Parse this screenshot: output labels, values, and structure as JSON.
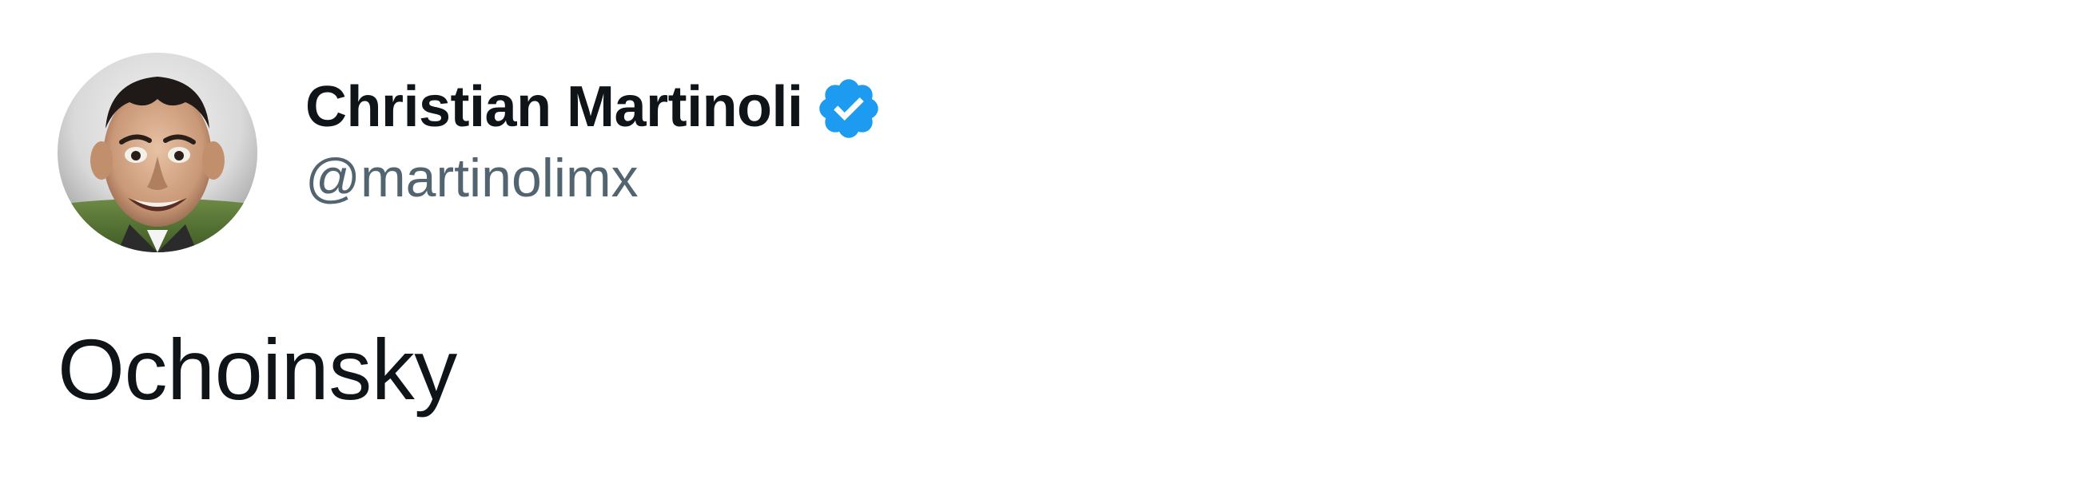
{
  "author": {
    "display_name": "Christian Martinoli",
    "handle": "@martinolimx",
    "verified": true,
    "avatar_icon": "profile-photo-avatar"
  },
  "tweet": {
    "text": "Ochoinsky"
  },
  "colors": {
    "name": "#0f1419",
    "handle": "#536471",
    "verified_badge": "#1d9bf0",
    "text": "#0f1419",
    "background": "#ffffff"
  }
}
